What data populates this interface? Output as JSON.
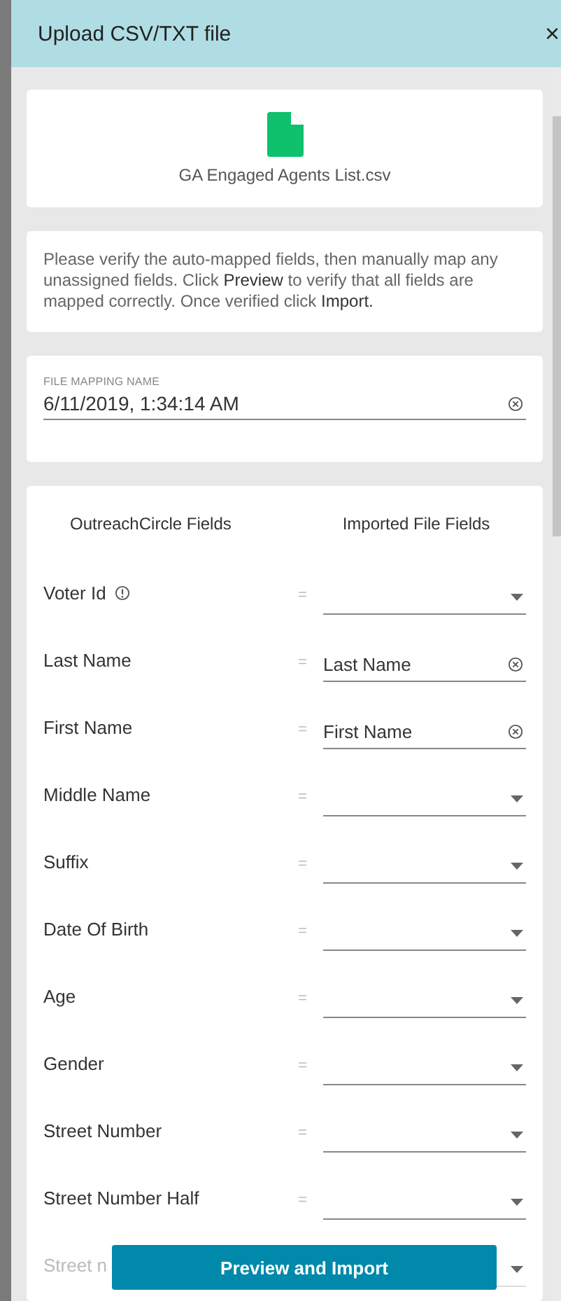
{
  "dialog": {
    "title": "Upload CSV/TXT file",
    "close": "×"
  },
  "file": {
    "name": "GA Engaged Agents List.csv"
  },
  "note": "Please verify the auto-mapped fields, then manually map any unassigned fields. Click **Preview** to verify that all fields are mapped correctly. Once verified click **Import.**",
  "mapping_name": {
    "label": "FILE MAPPING NAME",
    "value": "6/11/2019, 1:34:14 AM"
  },
  "mapping": {
    "columns": [
      "OutreachCircle Fields",
      "Imported File Fields"
    ],
    "separator": "=",
    "rows": [
      {
        "label": "Voter Id",
        "info": true,
        "kind": "select",
        "dimmed": false
      },
      {
        "label": "Last Name",
        "info": false,
        "kind": "mapped",
        "value": "Last Name",
        "dimmed": false
      },
      {
        "label": "First Name",
        "info": false,
        "kind": "mapped",
        "value": "First Name",
        "dimmed": false
      },
      {
        "label": "Middle Name",
        "info": false,
        "kind": "select",
        "dimmed": false
      },
      {
        "label": "Suffix",
        "info": false,
        "kind": "select",
        "dimmed": false
      },
      {
        "label": "Date Of Birth",
        "info": false,
        "kind": "select",
        "dimmed": false
      },
      {
        "label": "Age",
        "info": false,
        "kind": "select",
        "dimmed": false
      },
      {
        "label": "Gender",
        "info": false,
        "kind": "select",
        "dimmed": false
      },
      {
        "label": "Street Number",
        "info": false,
        "kind": "select",
        "dimmed": false
      },
      {
        "label": "Street Number Half",
        "info": false,
        "kind": "select",
        "dimmed": false
      },
      {
        "label": "Street n",
        "info": false,
        "kind": "select",
        "dimmed": true
      }
    ]
  },
  "action": "Preview and Import"
}
